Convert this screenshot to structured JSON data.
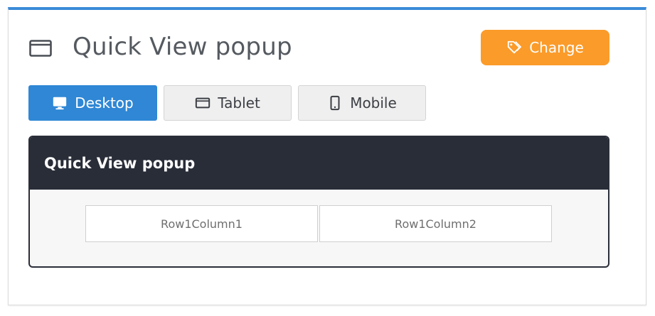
{
  "header": {
    "title": "Quick View popup",
    "icon": "window-icon",
    "change_label": "Change",
    "change_icon": "tags-icon"
  },
  "tabs": [
    {
      "label": "Desktop",
      "icon": "desktop-icon",
      "active": true
    },
    {
      "label": "Tablet",
      "icon": "tablet-icon",
      "active": false
    },
    {
      "label": "Mobile",
      "icon": "mobile-icon",
      "active": false
    }
  ],
  "preview": {
    "title": "Quick View popup",
    "row1": [
      "Row1Column1",
      "Row1Column2"
    ]
  },
  "colors": {
    "accent_blue": "#2f87d5",
    "top_border": "#3a8ad8",
    "change_orange": "#fb9b2a",
    "preview_dark": "#292d38"
  }
}
